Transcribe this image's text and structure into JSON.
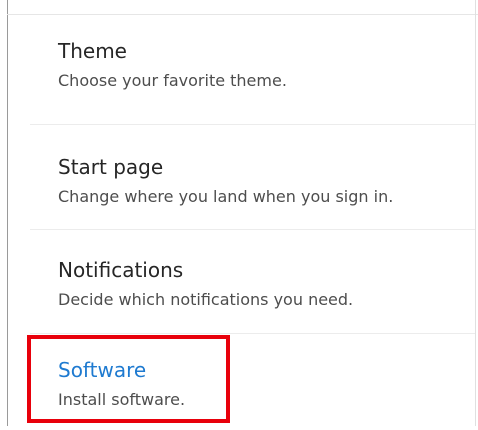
{
  "settings": {
    "items": [
      {
        "title": "Theme",
        "description": "Choose your favorite theme."
      },
      {
        "title": "Start page",
        "description": "Change where you land when you sign in."
      },
      {
        "title": "Notifications",
        "description": "Decide which notifications you need."
      },
      {
        "title": "Software",
        "description": "Install software."
      }
    ],
    "highlight_color": "#e8000b",
    "link_color": "#1e7ad0"
  }
}
